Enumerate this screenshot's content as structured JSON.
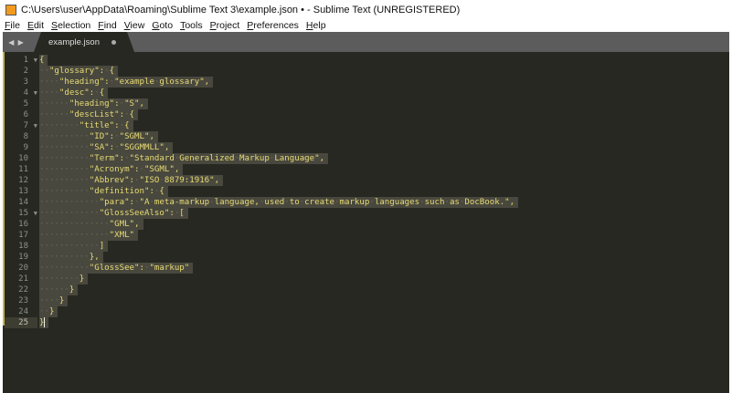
{
  "window": {
    "title": "C:\\Users\\user\\AppData\\Roaming\\Sublime Text 3\\example.json • - Sublime Text (UNREGISTERED)",
    "logo": "S"
  },
  "menu": [
    "File",
    "Edit",
    "Selection",
    "Find",
    "View",
    "Goto",
    "Tools",
    "Project",
    "Preferences",
    "Help"
  ],
  "tab": {
    "label": "example.json",
    "modified": true
  },
  "nav": "◀ ▶",
  "editor": {
    "current_line": 25,
    "fold_lines": [
      1,
      4,
      7,
      15
    ],
    "lines": [
      "{",
      "  \"glossary\": {",
      "    \"heading\": \"example glossary\",",
      "    \"desc\": {",
      "      \"heading\": \"S\",",
      "      \"descList\": {",
      "        \"title\": {",
      "          \"ID\": \"SGML\",",
      "          \"SA\": \"SGGMMLL\",",
      "          \"Term\": \"Standard Generalized Markup Language\",",
      "          \"Acronym\": \"SGML\",",
      "          \"Abbrev\": \"ISO 8879:1916\",",
      "          \"definition\": {",
      "            \"para\": \"A meta-markup language, used to create markup languages such as DocBook.\",",
      "            \"GlossSeeAlso\": [",
      "              \"GML\",",
      "              \"XML\"",
      "            ]",
      "          },",
      "          \"GlossSee\": \"markup\"",
      "        }",
      "      }",
      "    }",
      "  }",
      "}"
    ]
  }
}
